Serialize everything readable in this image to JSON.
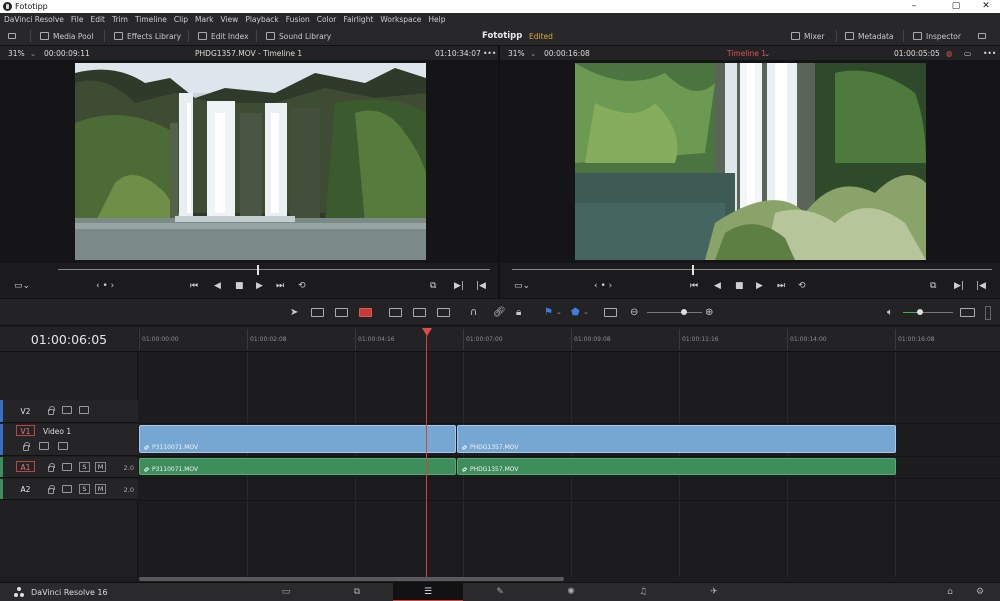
{
  "window": {
    "title": "Fototipp",
    "minimize": "–",
    "maximize": "▢",
    "close": "✕"
  },
  "menu": [
    "DaVinci Resolve",
    "File",
    "Edit",
    "Trim",
    "Timeline",
    "Clip",
    "Mark",
    "View",
    "Playback",
    "Fusion",
    "Color",
    "Fairlight",
    "Workspace",
    "Help"
  ],
  "toolbar": {
    "media_pool": "Media Pool",
    "effects_library": "Effects Library",
    "edit_index": "Edit Index",
    "sound_library": "Sound Library",
    "project_title": "Fototipp",
    "status": "Edited",
    "mixer": "Mixer",
    "metadata": "Metadata",
    "inspector": "Inspector"
  },
  "source_viewer": {
    "zoom": "31%",
    "timecode": "00:00:09:11",
    "clip_title": "PHDG1357.MOV - Timeline 1",
    "duration": "01:10:34:07",
    "scrub_position": 0.46
  },
  "timeline_viewer": {
    "zoom": "31%",
    "timecode": "00:00:16:08",
    "timeline_name": "Timeline 1",
    "current_timecode": "01:00:05:05",
    "scrub_position": 0.375
  },
  "timeline": {
    "current_timecode": "01:00:06:05",
    "ruler_labels": [
      "01:00:00:00",
      "01:00:02:08",
      "01:00:04:16",
      "01:00:07:00",
      "01:00:09:08",
      "01:00:11:16",
      "01:00:14:00",
      "01:00:16:08"
    ],
    "tracks": {
      "v2": {
        "id": "V2"
      },
      "v1": {
        "id": "V1",
        "name": "Video 1"
      },
      "a1": {
        "id": "A1",
        "level": "2.0",
        "solo": "S",
        "mute": "M"
      },
      "a2": {
        "id": "A2",
        "level": "2.0",
        "solo": "S",
        "mute": "M"
      }
    },
    "video_clips": [
      {
        "name": "P3110071.MOV"
      },
      {
        "name": "PHDG1357.MOV"
      }
    ],
    "audio_clips": [
      {
        "name": "P3110071.MOV"
      },
      {
        "name": "PHDG1357.MOV"
      }
    ]
  },
  "pagebar": {
    "brand": "DaVinci Resolve 16",
    "active_page": "edit"
  },
  "colors": {
    "video_clip": "#76a7d3",
    "audio_clip": "#3e8d5c",
    "playhead": "#d2423f",
    "edited": "#d9a63c"
  }
}
